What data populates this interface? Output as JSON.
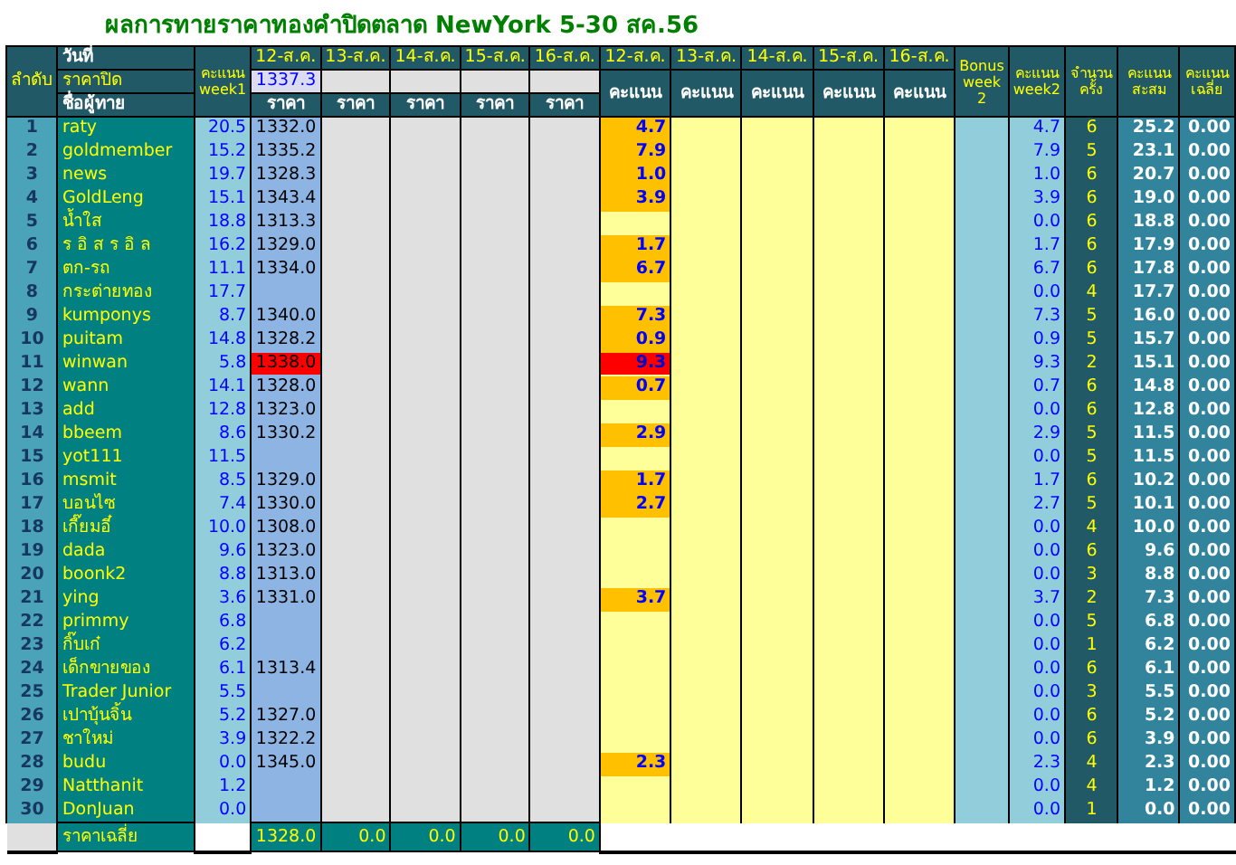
{
  "title": "ผลการทายราคาทองคำปิดตลาด NewYork 5-30 สค.56",
  "header": {
    "rank_label": "ลำดับ",
    "date_label": "วันที่",
    "close_label": "ราคาปิด",
    "name_label": "ชื่อผู้ทาย",
    "week1_label": "คะแนน week1",
    "price_columns": [
      {
        "date": "12-ส.ค.",
        "close": "1337.3",
        "label": "ราคา"
      },
      {
        "date": "13-ส.ค.",
        "label": "ราคา"
      },
      {
        "date": "14-ส.ค.",
        "label": "ราคา"
      },
      {
        "date": "15-ส.ค.",
        "label": "ราคา"
      },
      {
        "date": "16-ส.ค.",
        "label": "ราคา"
      }
    ],
    "score_columns": [
      {
        "date": "12-ส.ค.",
        "label": "คะแนน"
      },
      {
        "date": "13-ส.ค.",
        "label": "คะแนน"
      },
      {
        "date": "14-ส.ค.",
        "label": "คะแนน"
      },
      {
        "date": "15-ส.ค.",
        "label": "คะแนน"
      },
      {
        "date": "16-ส.ค.",
        "label": "คะแนน"
      }
    ],
    "bonus_label": "Bonus week 2",
    "week2_label": "คะแนน week2",
    "count_label": "จำนวนครั้ง",
    "total_label": "คะแนนสะสม",
    "avg_label": "คะแนนเฉลี่ย"
  },
  "rows": [
    {
      "rank": "1",
      "name": "raty",
      "week1": "20.5",
      "price": "1332.0",
      "score": "4.7",
      "flagged": false,
      "week2": "4.7",
      "count": "6",
      "total": "25.2",
      "avg": "0.00"
    },
    {
      "rank": "2",
      "name": "goldmember",
      "week1": "15.2",
      "price": "1335.2",
      "score": "7.9",
      "flagged": false,
      "week2": "7.9",
      "count": "5",
      "total": "23.1",
      "avg": "0.00"
    },
    {
      "rank": "3",
      "name": "news",
      "week1": "19.7",
      "price": "1328.3",
      "score": "1.0",
      "flagged": false,
      "week2": "1.0",
      "count": "6",
      "total": "20.7",
      "avg": "0.00"
    },
    {
      "rank": "4",
      "name": "GoldLeng",
      "week1": "15.1",
      "price": "1343.4",
      "score": "3.9",
      "flagged": false,
      "week2": "3.9",
      "count": "6",
      "total": "19.0",
      "avg": "0.00"
    },
    {
      "rank": "5",
      "name": "น้ำใส",
      "week1": "18.8",
      "price": "1313.3",
      "flagged": false,
      "week2": "0.0",
      "count": "6",
      "total": "18.8",
      "avg": "0.00"
    },
    {
      "rank": "6",
      "name": "ร อิ ส ร อิ ล",
      "week1": "16.2",
      "price": "1329.0",
      "score": "1.7",
      "flagged": false,
      "week2": "1.7",
      "count": "6",
      "total": "17.9",
      "avg": "0.00"
    },
    {
      "rank": "7",
      "name": "ตก-รถ",
      "week1": "11.1",
      "price": "1334.0",
      "score": "6.7",
      "flagged": false,
      "week2": "6.7",
      "count": "6",
      "total": "17.8",
      "avg": "0.00"
    },
    {
      "rank": "8",
      "name": "กระต่ายทอง",
      "week1": "17.7",
      "flagged": false,
      "week2": "0.0",
      "count": "4",
      "total": "17.7",
      "avg": "0.00"
    },
    {
      "rank": "9",
      "name": "kumponys",
      "week1": "8.7",
      "price": "1340.0",
      "score": "7.3",
      "flagged": false,
      "week2": "7.3",
      "count": "5",
      "total": "16.0",
      "avg": "0.00"
    },
    {
      "rank": "10",
      "name": "puitam",
      "week1": "14.8",
      "price": "1328.2",
      "score": "0.9",
      "flagged": false,
      "week2": "0.9",
      "count": "5",
      "total": "15.7",
      "avg": "0.00"
    },
    {
      "rank": "11",
      "name": "winwan",
      "week1": "5.8",
      "price": "1338.0",
      "score": "9.3",
      "flagged": true,
      "week2": "9.3",
      "count": "2",
      "total": "15.1",
      "avg": "0.00"
    },
    {
      "rank": "12",
      "name": "wann",
      "week1": "14.1",
      "price": "1328.0",
      "score": "0.7",
      "flagged": false,
      "week2": "0.7",
      "count": "6",
      "total": "14.8",
      "avg": "0.00"
    },
    {
      "rank": "13",
      "name": "add",
      "week1": "12.8",
      "price": "1323.0",
      "flagged": false,
      "week2": "0.0",
      "count": "6",
      "total": "12.8",
      "avg": "0.00"
    },
    {
      "rank": "14",
      "name": "bbeem",
      "week1": "8.6",
      "price": "1330.2",
      "score": "2.9",
      "flagged": false,
      "week2": "2.9",
      "count": "5",
      "total": "11.5",
      "avg": "0.00"
    },
    {
      "rank": "15",
      "name": "yot111",
      "week1": "11.5",
      "flagged": false,
      "week2": "0.0",
      "count": "5",
      "total": "11.5",
      "avg": "0.00"
    },
    {
      "rank": "16",
      "name": "msmit",
      "week1": "8.5",
      "price": "1329.0",
      "score": "1.7",
      "flagged": false,
      "week2": "1.7",
      "count": "6",
      "total": "10.2",
      "avg": "0.00"
    },
    {
      "rank": "17",
      "name": "บอนไซ",
      "week1": "7.4",
      "price": "1330.0",
      "score": "2.7",
      "flagged": false,
      "week2": "2.7",
      "count": "5",
      "total": "10.1",
      "avg": "0.00"
    },
    {
      "rank": "18",
      "name": "เกี๊ยมอี๋",
      "week1": "10.0",
      "price": "1308.0",
      "flagged": false,
      "week2": "0.0",
      "count": "4",
      "total": "10.0",
      "avg": "0.00"
    },
    {
      "rank": "19",
      "name": "dada",
      "week1": "9.6",
      "price": "1323.0",
      "flagged": false,
      "week2": "0.0",
      "count": "6",
      "total": "9.6",
      "avg": "0.00"
    },
    {
      "rank": "20",
      "name": "boonk2",
      "week1": "8.8",
      "price": "1313.0",
      "flagged": false,
      "week2": "0.0",
      "count": "3",
      "total": "8.8",
      "avg": "0.00"
    },
    {
      "rank": "21",
      "name": "ying",
      "week1": "3.6",
      "price": "1331.0",
      "score": "3.7",
      "flagged": false,
      "week2": "3.7",
      "count": "2",
      "total": "7.3",
      "avg": "0.00"
    },
    {
      "rank": "22",
      "name": "primmy",
      "week1": "6.8",
      "flagged": false,
      "week2": "0.0",
      "count": "5",
      "total": "6.8",
      "avg": "0.00"
    },
    {
      "rank": "23",
      "name": "กิ๊บเก๋",
      "week1": "6.2",
      "flagged": false,
      "week2": "0.0",
      "count": "1",
      "total": "6.2",
      "avg": "0.00"
    },
    {
      "rank": "24",
      "name": "เด็กขายของ",
      "week1": "6.1",
      "price": "1313.4",
      "flagged": false,
      "week2": "0.0",
      "count": "6",
      "total": "6.1",
      "avg": "0.00"
    },
    {
      "rank": "25",
      "name": "Trader Junior",
      "week1": "5.5",
      "flagged": false,
      "week2": "0.0",
      "count": "3",
      "total": "5.5",
      "avg": "0.00"
    },
    {
      "rank": "26",
      "name": "เปาบุ้นจิ้น",
      "week1": "5.2",
      "price": "1327.0",
      "flagged": false,
      "week2": "0.0",
      "count": "6",
      "total": "5.2",
      "avg": "0.00"
    },
    {
      "rank": "27",
      "name": "ชาใหม่",
      "week1": "3.9",
      "price": "1322.2",
      "flagged": false,
      "week2": "0.0",
      "count": "6",
      "total": "3.9",
      "avg": "0.00"
    },
    {
      "rank": "28",
      "name": "budu",
      "week1": "0.0",
      "price": "1345.0",
      "score": "2.3",
      "flagged": false,
      "week2": "2.3",
      "count": "4",
      "total": "2.3",
      "avg": "0.00"
    },
    {
      "rank": "29",
      "name": "Natthanit",
      "week1": "1.2",
      "flagged": false,
      "week2": "0.0",
      "count": "4",
      "total": "1.2",
      "avg": "0.00"
    },
    {
      "rank": "30",
      "name": "DonJuan",
      "week1": "0.0",
      "flagged": false,
      "week2": "0.0",
      "count": "1",
      "total": "0.0",
      "avg": "0.00"
    }
  ],
  "footer": {
    "label": "ราคาเฉลี่ย",
    "prices": [
      "1328.0",
      "0.0",
      "0.0",
      "0.0",
      "0.0"
    ]
  }
}
